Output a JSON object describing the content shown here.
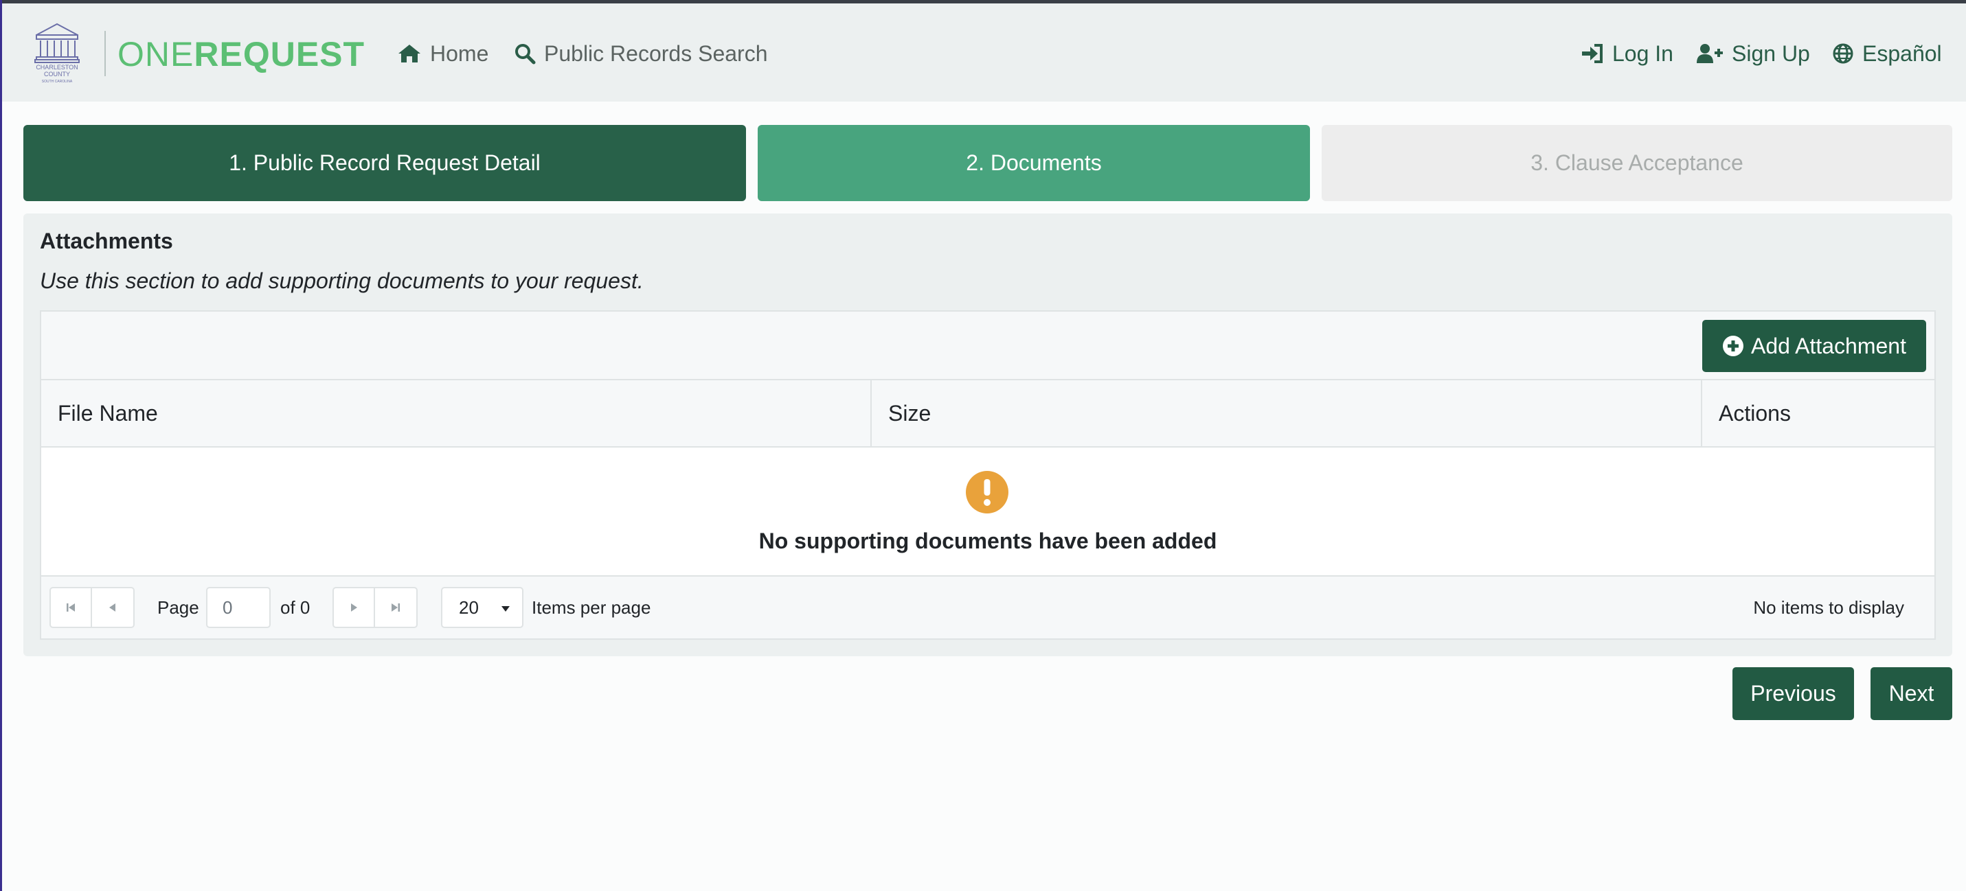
{
  "header": {
    "seal_caption": [
      "CHARLESTON",
      "COUNTY",
      "SOUTH CAROLINA"
    ],
    "brand_one": "ONE",
    "brand_request": "REQUEST",
    "nav": [
      {
        "label": "Home",
        "icon": "home-icon"
      },
      {
        "label": "Public Records Search",
        "icon": "search-icon"
      }
    ],
    "nav_right": [
      {
        "label": "Log In",
        "icon": "sign-in-icon"
      },
      {
        "label": "Sign Up",
        "icon": "user-plus-icon"
      },
      {
        "label": "Español",
        "icon": "globe-icon"
      }
    ]
  },
  "steps": [
    {
      "label": "1. Public Record Request Detail",
      "state": "completed"
    },
    {
      "label": "2. Documents",
      "state": "active"
    },
    {
      "label": "3. Clause Acceptance",
      "state": "disabled"
    }
  ],
  "attachments": {
    "title": "Attachments",
    "description": "Use this section to add supporting documents to your request.",
    "add_button": "Add Attachment",
    "columns": [
      "File Name",
      "Size",
      "Actions"
    ],
    "rows": [],
    "empty_message": "No supporting documents have been added",
    "pager": {
      "page_label": "Page",
      "page_value": "0",
      "of_label": "of 0",
      "page_size": "20",
      "items_per_page_label": "Items per page",
      "info": "No items to display"
    }
  },
  "footer": {
    "previous_label": "Previous",
    "next_label": "Next"
  },
  "colors": {
    "primary_dark": "#225a43",
    "step_active": "#48a47e",
    "brand_green": "#5cbf74",
    "warning": "#e9a23b"
  }
}
